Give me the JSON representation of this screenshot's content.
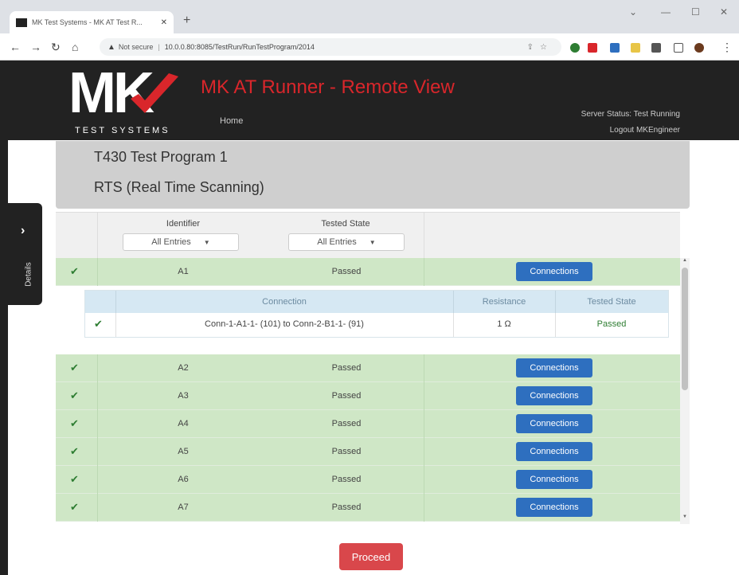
{
  "browser": {
    "tab_title": "MK Test Systems - MK AT Test R...",
    "address_warning": "Not secure",
    "url": "10.0.0.80:8085/TestRun/RunTestProgram/2014"
  },
  "header": {
    "logo_text": "MK",
    "logo_subtext": "TEST SYSTEMS",
    "title": "MK AT Runner - Remote View",
    "nav_home": "Home",
    "server_status": "Server Status: Test Running",
    "logout": "Logout MKEngineer"
  },
  "sidebar": {
    "details_label": "Details"
  },
  "program": {
    "name": "T430 Test Program 1",
    "mode": "RTS (Real Time Scanning)"
  },
  "table": {
    "col_identifier": "Identifier",
    "col_state": "Tested State",
    "filter_identifier": "All Entries",
    "filter_state": "All Entries",
    "connections_label": "Connections",
    "rows": [
      {
        "id": "A1",
        "state": "Passed"
      },
      {
        "id": "A2",
        "state": "Passed"
      },
      {
        "id": "A3",
        "state": "Passed"
      },
      {
        "id": "A4",
        "state": "Passed"
      },
      {
        "id": "A5",
        "state": "Passed"
      },
      {
        "id": "A6",
        "state": "Passed"
      },
      {
        "id": "A7",
        "state": "Passed"
      }
    ],
    "sub": {
      "col_connection": "Connection",
      "col_resistance": "Resistance",
      "col_state": "Tested State",
      "row": {
        "connection": "Conn-1-A1-1- (101) to Conn-2-B1-1- (91)",
        "resistance": "1 Ω",
        "state": "Passed"
      }
    }
  },
  "actions": {
    "proceed": "Proceed"
  },
  "colors": {
    "brand_red": "#d9262b",
    "pass_green": "#cfe7c6",
    "button_blue": "#2e6fbf"
  }
}
